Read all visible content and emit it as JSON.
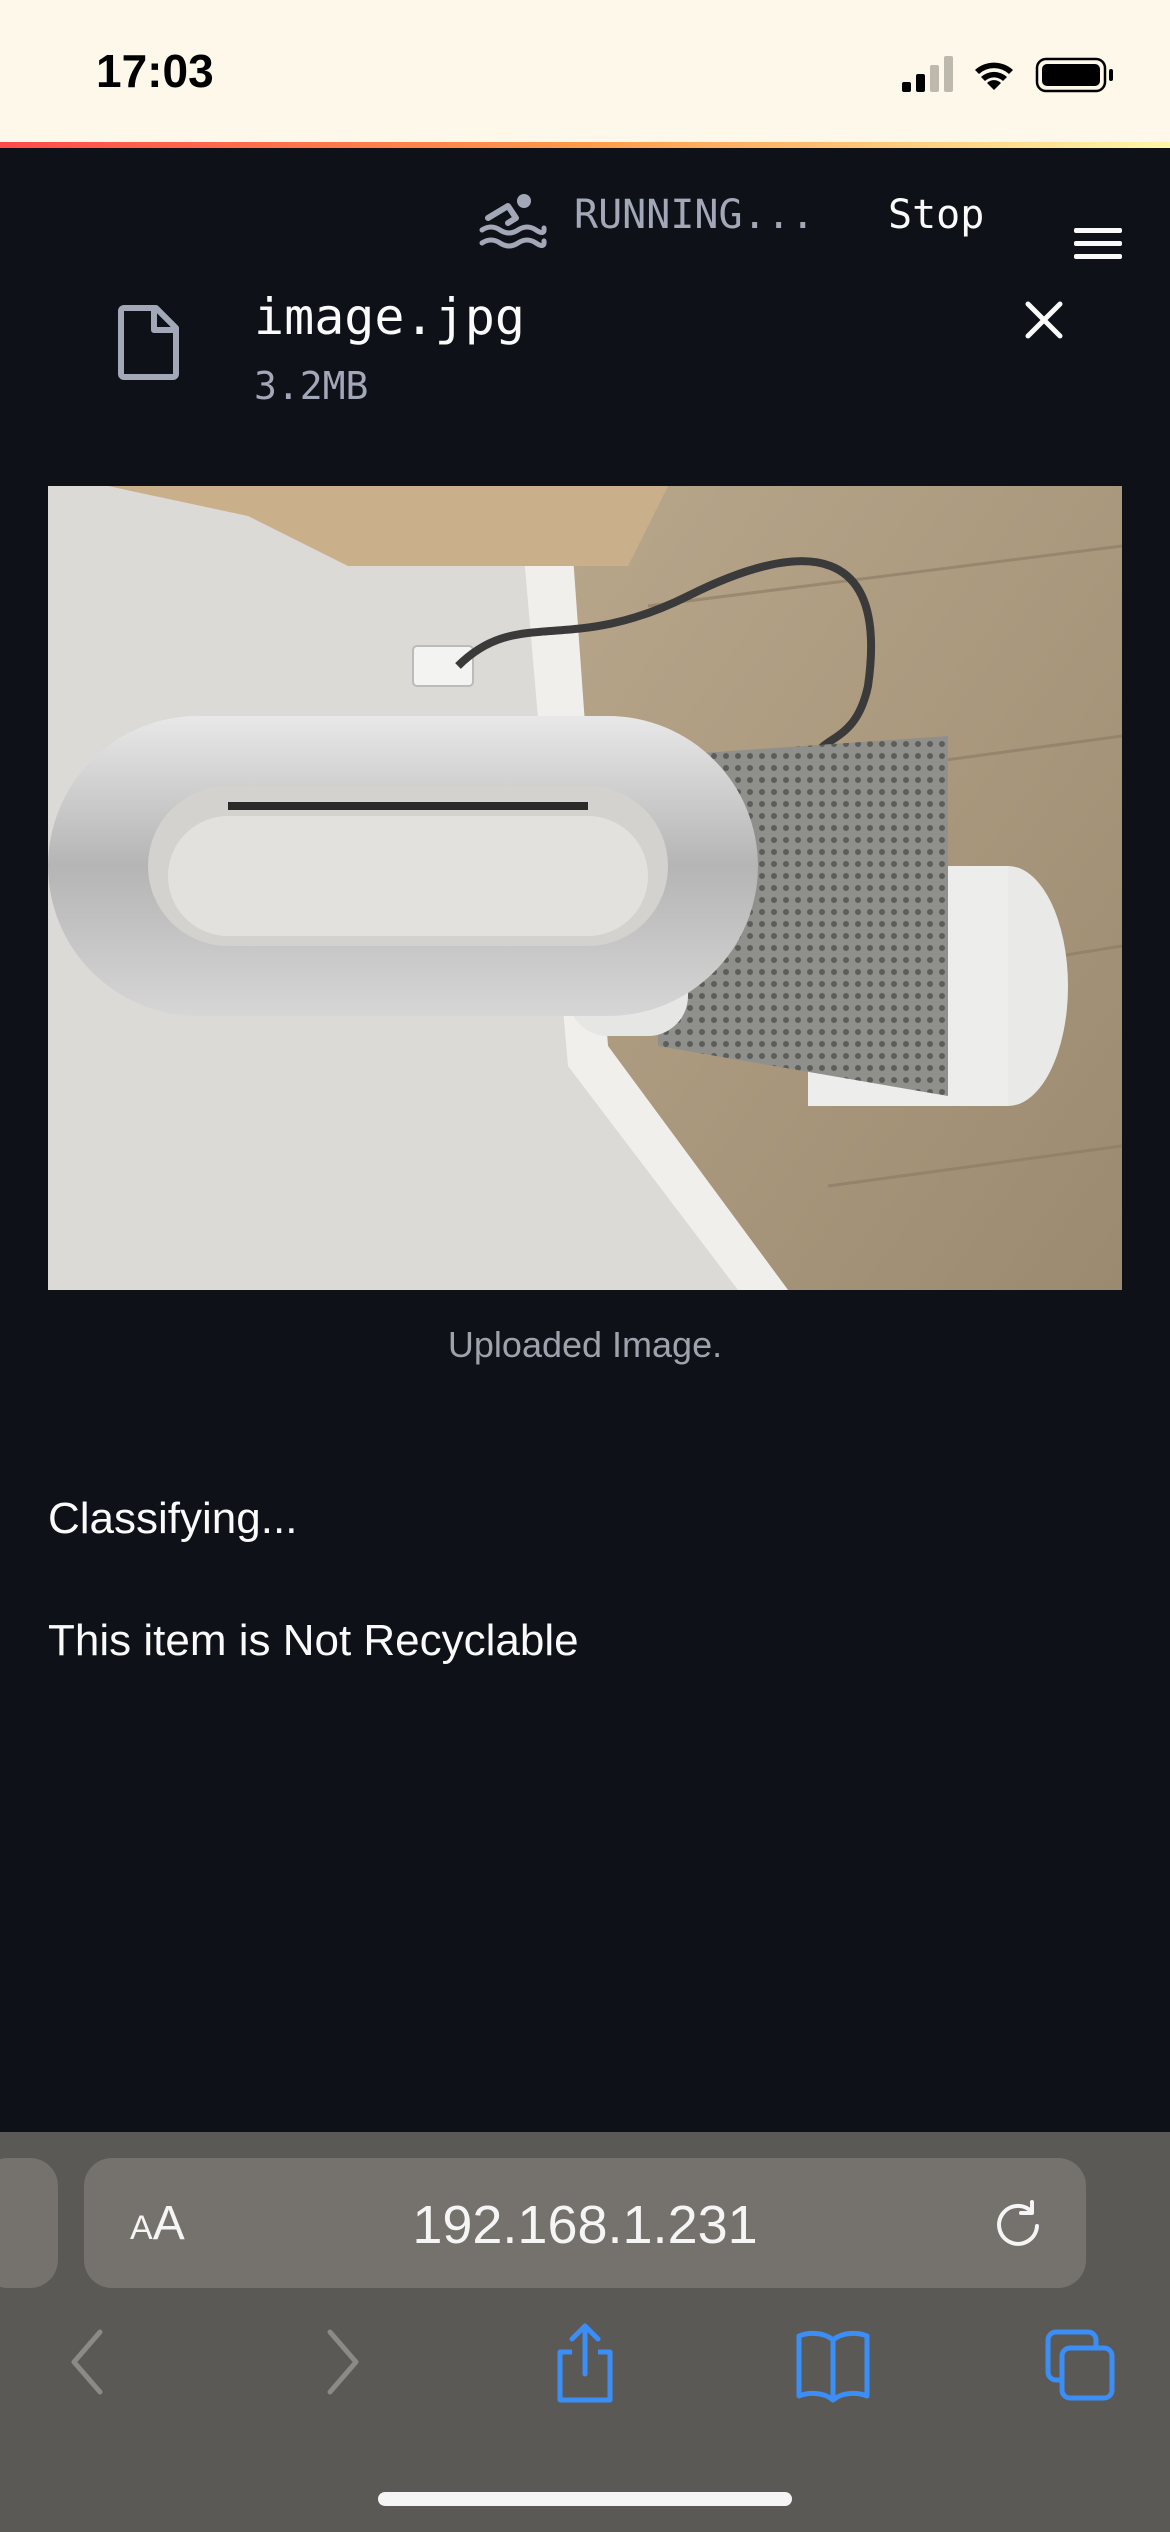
{
  "status_bar": {
    "time": "17:03"
  },
  "toolbar": {
    "running_label": "RUNNING...",
    "stop_label": "Stop",
    "running_icon": "swimmer-icon",
    "menu_icon": "hamburger-icon"
  },
  "file": {
    "name": "image.jpg",
    "size": "3.2MB",
    "icon": "file-icon",
    "close_icon": "close-icon"
  },
  "image": {
    "caption": "Uploaded Image."
  },
  "messages": {
    "classifying": "Classifying...",
    "result": "This item is Not Recyclable"
  },
  "browser": {
    "url": "192.168.1.231",
    "text_size_small": "A",
    "text_size_big": "A"
  },
  "colors": {
    "background": "#0e1117",
    "status_bar": "#fdf8e9",
    "browser_bar": "#5b5955",
    "accent_blue": "#3b8ef5"
  }
}
